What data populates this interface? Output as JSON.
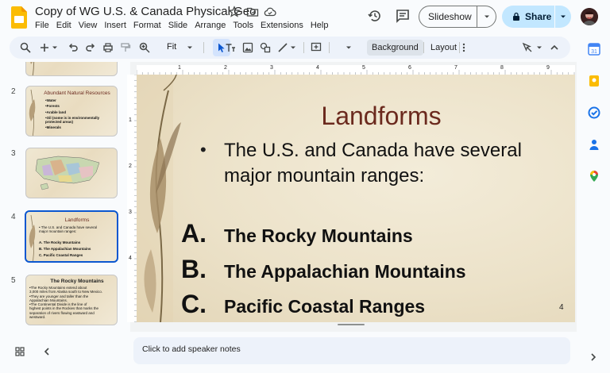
{
  "header": {
    "doc_title": "Copy of WG U.S. & Canada Physical Geo",
    "menu": [
      "File",
      "Edit",
      "View",
      "Insert",
      "Format",
      "Slide",
      "Arrange",
      "Tools",
      "Extensions",
      "Help"
    ],
    "slideshow_label": "Slideshow",
    "share_label": "Share"
  },
  "toolbar": {
    "zoom": "Fit",
    "background_label": "Background",
    "layout_label": "Layout"
  },
  "filmstrip": {
    "slides": [
      {
        "num": "2",
        "title": "Abundant Natural Resources",
        "lines": [
          "•Water",
          "•Forests",
          "•Arable land",
          "•Oil (some is in environmentally",
          "  protected areas)",
          "•Minerals"
        ]
      },
      {
        "num": "3"
      },
      {
        "num": "4",
        "title": "Landforms",
        "lines": [
          "•  The U.S. and Canada have several",
          "   major mountain ranges:"
        ],
        "list": [
          "A.  The Rocky Mountains",
          "B.  The Appalachian Mountains",
          "C.  Pacific Coastal Ranges"
        ]
      },
      {
        "num": "5",
        "title": "The Rocky Mountains",
        "lines": [
          "•The Rocky Mountains extend about",
          "3,000 miles from Alaska south to New Mexico.",
          "•They are younger and taller than the",
          "Appalachian Mountains.",
          "•The Continental Divide is the line of",
          "highest points in the Rockies that marks the",
          "separation of rivers flowing eastward and",
          "westward."
        ]
      }
    ]
  },
  "slide": {
    "title": "Landforms",
    "bullet": "The U.S. and Canada have several major mountain ranges:",
    "list": [
      {
        "letter": "A.",
        "text": "The Rocky Mountains"
      },
      {
        "letter": "B.",
        "text": "The Appalachian Mountains"
      },
      {
        "letter": "C.",
        "text": "Pacific Coastal Ranges"
      }
    ],
    "number": "4"
  },
  "ruler": {
    "labels": [
      "1",
      "2",
      "3",
      "4",
      "5",
      "6",
      "7",
      "8",
      "9"
    ],
    "side_labels": [
      "1",
      "2",
      "3",
      "4"
    ]
  },
  "notes": {
    "placeholder": "Click to add speaker notes"
  },
  "colors": {
    "accent": "#0b57d0",
    "share_bg": "#c2e7ff",
    "slide_title": "#6b2a1e"
  }
}
